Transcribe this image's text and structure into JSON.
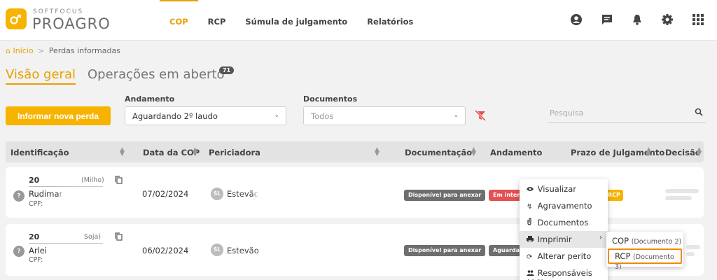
{
  "brand": {
    "small": "SOFTFOCUS",
    "big": "PROAGRO",
    "accent": "#f6b400"
  },
  "nav": [
    {
      "label": "COP",
      "active": true
    },
    {
      "label": "RCP"
    },
    {
      "label": "Súmula de julgamento"
    },
    {
      "label": "Relatórios"
    }
  ],
  "header_icons": [
    "user-circle-icon",
    "chat-icon",
    "bell-icon",
    "gear-icon",
    "apps-grid-icon"
  ],
  "breadcrumb": {
    "home": "Início",
    "sep": ">",
    "current": "Perdas informadas"
  },
  "page_tabs": {
    "overview": "Visão geral",
    "open_ops": "Operações em aberto",
    "open_ops_count": "71"
  },
  "filters": {
    "new_loss_button": "Informar nova perda",
    "status_label": "Andamento",
    "status_value": "Aguardando 2º laudo",
    "docs_label": "Documentos",
    "docs_value": "Todos",
    "search_placeholder": "Pesquisa"
  },
  "table": {
    "columns": [
      "Identificação",
      "Data da COP",
      "Periciadora",
      "Documentação",
      "Andamento",
      "Prazo de Julgamento",
      "Decisão"
    ],
    "rows": [
      {
        "id_prefix": "20",
        "id_tag": "(Milho)",
        "name": "Rudimar",
        "cpf_label": "CPF:",
        "avatar": "?",
        "date": "07/02/2024",
        "perito_initials": "SL",
        "perito": "Estevão",
        "doc_status": "Disponível para anexar",
        "status": "Em interpo",
        "deadline": "RCP"
      },
      {
        "id_prefix": "20",
        "id_tag": "Soja)",
        "name": "Arlei",
        "cpf_label": "CPF:",
        "avatar": "?",
        "date": "06/02/2024",
        "perito_initials": "SL",
        "perito": "Estevão",
        "doc_status": "Disponível para anexar",
        "status": "Aguardan"
      }
    ]
  },
  "context_menu": {
    "items": [
      {
        "label": "Visualizar",
        "icon": "eye-icon"
      },
      {
        "label": "Agravamento",
        "icon": "lightning-icon"
      },
      {
        "label": "Documentos",
        "icon": "paperclip-icon"
      },
      {
        "label": "Imprimir",
        "icon": "printer-icon",
        "highlighted": true
      },
      {
        "label": "Alterar perito",
        "icon": "refresh-icon"
      },
      {
        "label": "Responsáveis (CC)",
        "icon": "people-icon"
      }
    ],
    "submenu": [
      {
        "label": "COP",
        "detail": "(Documento 2)"
      },
      {
        "label": "RCP",
        "detail": "(Documento 3)",
        "highlighted": true
      }
    ]
  }
}
